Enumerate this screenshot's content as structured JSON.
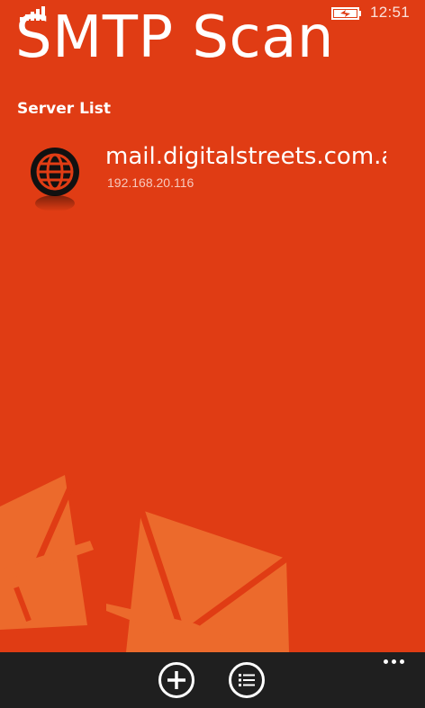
{
  "status_bar": {
    "time": "12:51",
    "signal_icon": "signal-strength-icon",
    "battery_icon": "battery-charging-icon"
  },
  "app": {
    "title": "SMTP Scan",
    "section_label": "Server List"
  },
  "servers": [
    {
      "name": "mail.digitalstreets.com.au",
      "ip": "192.168.20.116",
      "icon": "globe-icon"
    }
  ],
  "app_bar": {
    "add_icon": "add-icon",
    "list_icon": "list-icon",
    "more_icon": "ellipsis-icon"
  },
  "colors": {
    "accent": "#E03C14",
    "decoration": "#EC6A2C",
    "app_bar_bg": "#1f1f1f",
    "text": "#ffffff"
  }
}
